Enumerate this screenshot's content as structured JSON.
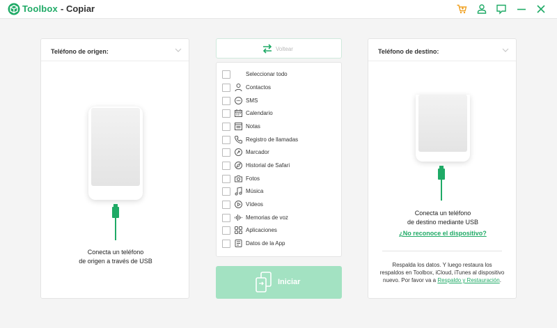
{
  "app": {
    "brand": "Toolbox",
    "title": "- Copiar",
    "accent": "#1faa66"
  },
  "titlebar_icons": [
    "cart-icon",
    "user-icon",
    "feedback-icon",
    "minimize-icon",
    "close-icon"
  ],
  "source": {
    "title": "Teléfono de origen:",
    "connect_line1": "Conecta un teléfono",
    "connect_line2": "de origen a través de USB"
  },
  "swap": {
    "label": "Voltear"
  },
  "items": [
    {
      "label": "Seleccionar todo",
      "icon": ""
    },
    {
      "label": "Contactos",
      "icon": "contacts-icon"
    },
    {
      "label": "SMS",
      "icon": "sms-icon"
    },
    {
      "label": "Calendario",
      "icon": "calendar-icon"
    },
    {
      "label": "Notas",
      "icon": "notes-icon"
    },
    {
      "label": "Registro de llamadas",
      "icon": "phone-icon"
    },
    {
      "label": "Marcador",
      "icon": "bookmark-icon"
    },
    {
      "label": "Historial de Safari",
      "icon": "safari-icon"
    },
    {
      "label": "Fotos",
      "icon": "camera-icon"
    },
    {
      "label": "Música",
      "icon": "music-icon"
    },
    {
      "label": "Vídeos",
      "icon": "video-icon"
    },
    {
      "label": "Memorias de voz",
      "icon": "voice-memo-icon"
    },
    {
      "label": "Aplicaciones",
      "icon": "apps-icon"
    },
    {
      "label": "Datos de la App",
      "icon": "app-data-icon"
    }
  ],
  "start": {
    "label": "Iniciar"
  },
  "destination": {
    "title": "Teléfono de destino:",
    "connect_line1": "Conecta un teléfono",
    "connect_line2": "de destino mediante USB",
    "not_recognized": "¿No reconoce el dispositivo?",
    "note_text": "Respalda los datos. Y luego restaura los respaldos en Toolbox, iCloud, iTunes al dispositivo nuevo. Por favor va a ",
    "note_link": "Respaldo y Restauración",
    "note_end": "."
  }
}
